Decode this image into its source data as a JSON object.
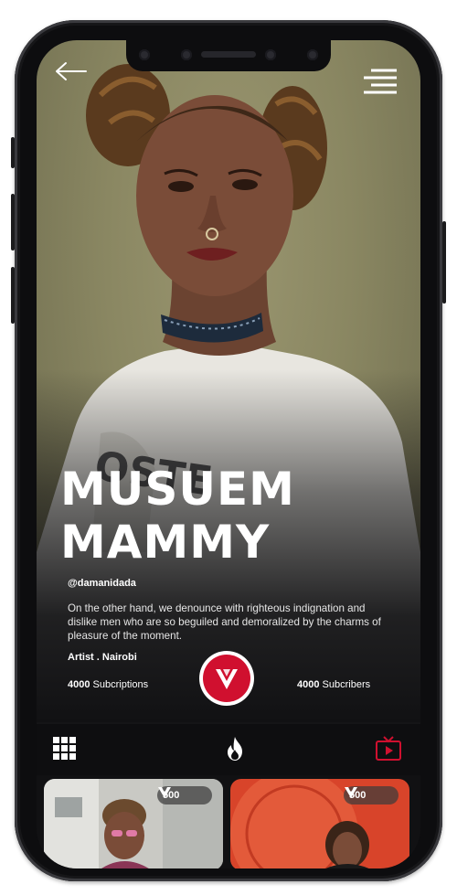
{
  "profile": {
    "title_line1": "MUSUEM",
    "title_line2": "MAMMY",
    "handle": "@damanidada",
    "bio": "On the other hand, we denounce with righteous indignation and dislike men who are so beguiled and demoralized by the charms of pleasure of the moment.",
    "role_location": "Artist . Nairobi"
  },
  "stats": {
    "subscriptions_count": "4000",
    "subscriptions_label": "Subcriptions",
    "subscribers_count": "4000",
    "subscribers_label": "Subcribers"
  },
  "header": {
    "back_icon": "arrow-left-icon",
    "menu_icon": "hamburger-menu-icon"
  },
  "tabs": [
    {
      "icon": "grid-icon",
      "active": false
    },
    {
      "icon": "flame-icon",
      "active": true
    },
    {
      "icon": "tv-play-icon",
      "active": false
    }
  ],
  "thumbnails": [
    {
      "badge_count": "500",
      "badge_icon": "v-logo-icon"
    },
    {
      "badge_count": "500",
      "badge_icon": "v-logo-icon"
    }
  ],
  "colors": {
    "accent": "#d0102f",
    "background": "#111113",
    "text": "#ffffff"
  }
}
